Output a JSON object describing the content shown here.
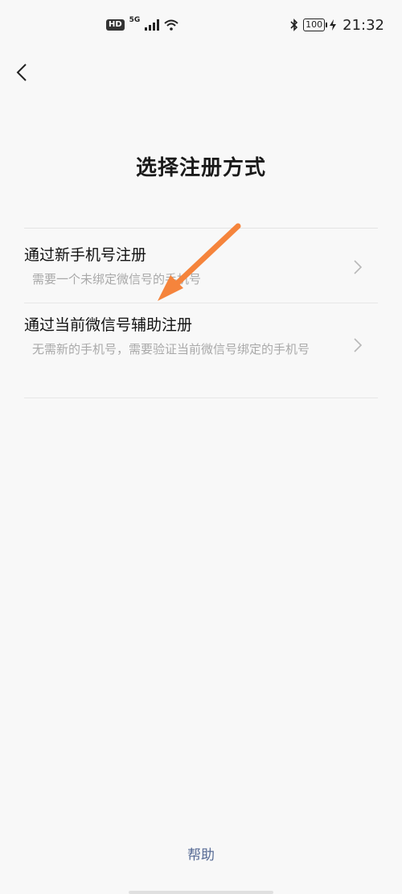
{
  "status_bar": {
    "hd": "HD",
    "network": "5G",
    "battery": "100",
    "time": "21:32"
  },
  "nav": {
    "back_icon": "chevron-left-icon"
  },
  "page": {
    "title": "选择注册方式",
    "options": [
      {
        "title": "通过新手机号注册",
        "description": "需要一个未绑定微信号的手机号"
      },
      {
        "title": "通过当前微信号辅助注册",
        "description": "无需新的手机号，需要验证当前微信号绑定的手机号"
      }
    ],
    "help": "帮助"
  },
  "colors": {
    "background": "#f8f8f8",
    "link": "#576b95",
    "annotation_arrow": "#f5843c"
  }
}
